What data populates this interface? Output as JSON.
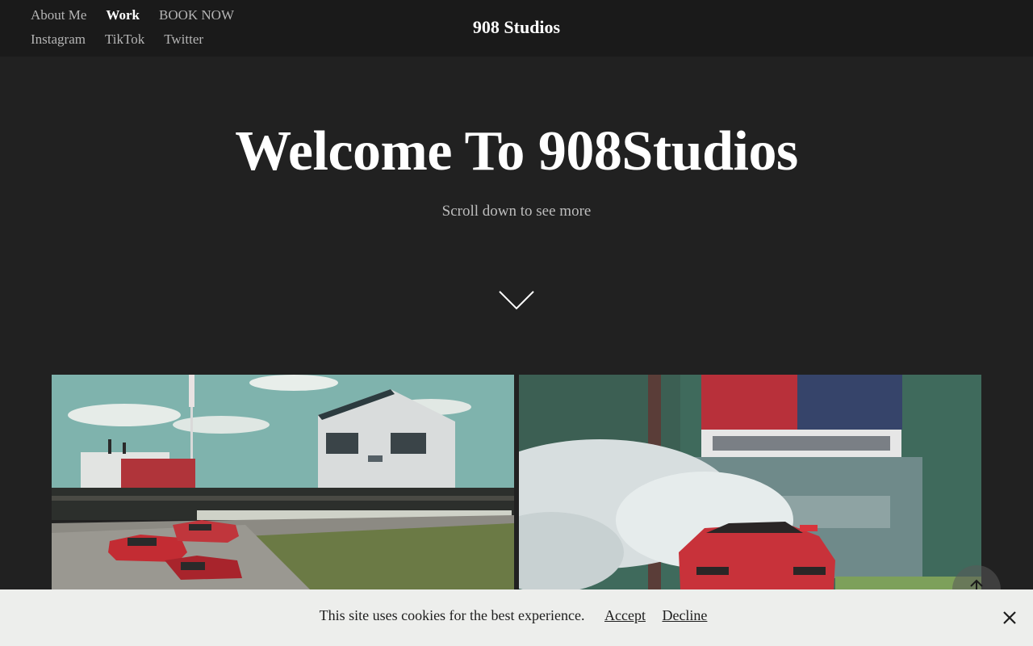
{
  "header": {
    "site_title": "908 Studios",
    "nav_row1": [
      "About Me",
      "Work",
      "BOOK NOW"
    ],
    "nav_row2": [
      "Instagram",
      "TikTok",
      "Twitter"
    ],
    "active_item": "Work"
  },
  "hero": {
    "title": "Welcome To 908Studios",
    "subtitle": "Scroll down to see more",
    "scroll_icon": "chevron-down-icon"
  },
  "gallery": {
    "images": [
      "drift-event-crowd-photo",
      "drift-car-smoke-photo"
    ]
  },
  "back_to_top_icon": "arrow-up-icon",
  "cookie": {
    "message": "This site uses cookies for the best experience.",
    "accept_label": "Accept",
    "decline_label": "Decline",
    "close_icon": "close-icon"
  },
  "colors": {
    "page_bg": "#212121",
    "header_bg": "#1a1a1a",
    "cookie_bg": "#edeeec",
    "car_red": "#c8323a"
  }
}
